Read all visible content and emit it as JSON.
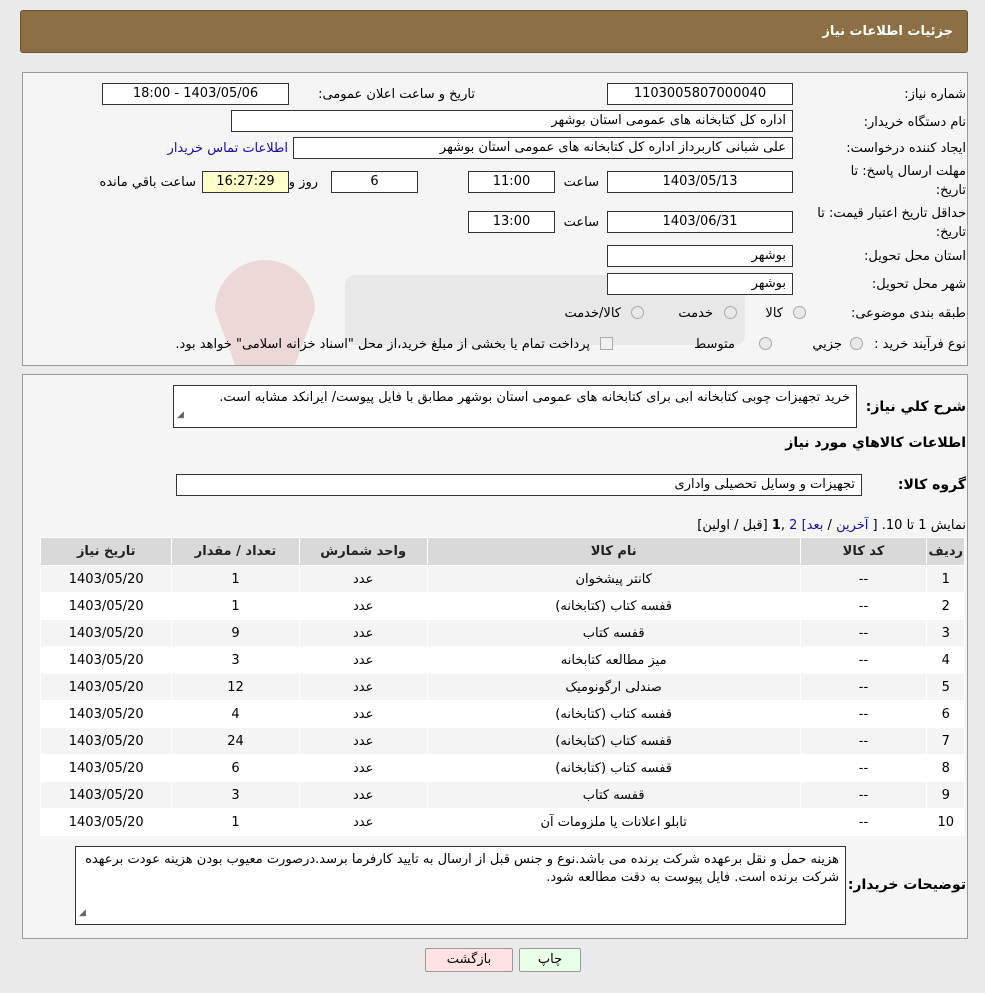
{
  "header": {
    "title": "جزئیات اطلاعات نیاز"
  },
  "form": {
    "need_number_label": "شماره نیاز:",
    "need_number": "1103005807000040",
    "announce_label": "تاریخ و ساعت اعلان عمومی:",
    "announce_value": "1403/05/06 - 18:00",
    "buyer_org_label": "نام دستگاه خریدار:",
    "buyer_org": "اداره کل کتابخانه های عمومی استان بوشهر",
    "creator_label": "ایجاد کننده درخواست:",
    "creator": "علی شبانی کاربرداز اداره کل کتابخانه های عمومی استان بوشهر",
    "contact_link": "اطلاعات تماس خریدار",
    "reply_deadline_label_1": "مهلت ارسال پاسخ: تا",
    "reply_deadline_label_2": "تاریخ:",
    "reply_date": "1403/05/13",
    "time_label": "ساعت",
    "reply_time": "11:00",
    "days_value": "6",
    "days_label": "روز و",
    "remaining_time": "16:27:29",
    "remaining_label": "ساعت باقي مانده",
    "validity_label_1": "حداقل تاریخ اعتبار قیمت: تا",
    "validity_label_2": "تاریخ:",
    "validity_date": "1403/06/31",
    "validity_time": "13:00",
    "province_label": "استان محل تحویل:",
    "province": "بوشهر",
    "city_label": "شهر محل تحویل:",
    "city": "بوشهر",
    "category_label": "طبقه بندی موضوعی:",
    "category_options": [
      "کالا",
      "خدمت",
      "کالا/خدمت"
    ],
    "process_label": "نوع فرآیند خرید :",
    "process_options": [
      "جزیي",
      "متوسط"
    ],
    "process_note": "پرداخت تمام یا بخشی از مبلغ خرید،از محل \"اسناد خزانه اسلامی\" خواهد بود."
  },
  "details": {
    "description_label": "شرح کلي نياز:",
    "description": "خرید تجهیزات چوبی کتابخانه ابی برای کتابخانه های عمومی استان بوشهر مطابق با فایل پیوست/ ایرانکد مشابه است.",
    "goods_info_title": "اطلاعات کالاهاي مورد نياز",
    "goods_group_label": "گروه کالا:",
    "goods_group": "تجهیزات و وسایل تحصیلی واداری",
    "pager": {
      "showing": "نمایش 1 تا 10.",
      "bracket_open": "[",
      "last": "آخرین",
      "slash1": "/",
      "next": "بعد]",
      "page2": "2",
      "comma": ",",
      "page1": "1",
      "prev_first": "[قبل / اولین]"
    },
    "table": {
      "headers": [
        "رديف",
        "کد کالا",
        "نام کالا",
        "واحد شمارش",
        "تعداد / مقدار",
        "تاریخ نیاز"
      ],
      "rows": [
        [
          "1",
          "--",
          "کانتر پیشخوان",
          "عدد",
          "1",
          "1403/05/20"
        ],
        [
          "2",
          "--",
          "قفسه کتاب (کتابخانه)",
          "عدد",
          "1",
          "1403/05/20"
        ],
        [
          "3",
          "--",
          "قفسه کتاب",
          "عدد",
          "9",
          "1403/05/20"
        ],
        [
          "4",
          "--",
          "میز مطالعه کتابخانه",
          "عدد",
          "3",
          "1403/05/20"
        ],
        [
          "5",
          "--",
          "صندلی ارگونومیک",
          "عدد",
          "12",
          "1403/05/20"
        ],
        [
          "6",
          "--",
          "قفسه کتاب (کتابخانه)",
          "عدد",
          "4",
          "1403/05/20"
        ],
        [
          "7",
          "--",
          "قفسه کتاب (کتابخانه)",
          "عدد",
          "24",
          "1403/05/20"
        ],
        [
          "8",
          "--",
          "قفسه کتاب (کتابخانه)",
          "عدد",
          "6",
          "1403/05/20"
        ],
        [
          "9",
          "--",
          "قفسه کتاب",
          "عدد",
          "3",
          "1403/05/20"
        ],
        [
          "10",
          "--",
          "تابلو اعلانات یا ملزومات آن",
          "عدد",
          "1",
          "1403/05/20"
        ]
      ]
    },
    "buyer_notes_label": "توضیحات خریدار:",
    "buyer_notes": "هزینه حمل و نقل برعهده شرکت برنده می باشد.نوع و جنس قبل از ارسال به تایید کارفرما برسد.درصورت معیوب بودن هزینه عودت برعهده شرکت برنده است. فایل پیوست به دقت مطالعه شود."
  },
  "buttons": {
    "print": "چاپ",
    "back": "بازگشت"
  },
  "colors": {
    "header_bg": "#8c6f45",
    "link": "#1a0dab",
    "print_btn": "#eaffea",
    "back_btn": "#ffe3e3"
  }
}
